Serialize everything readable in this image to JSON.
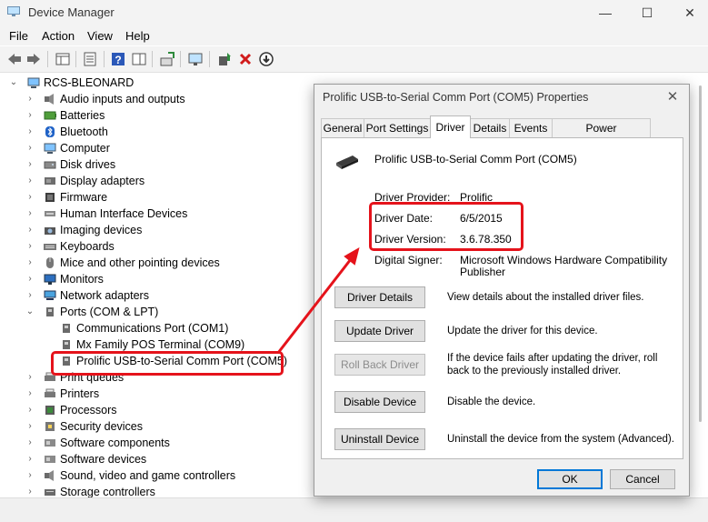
{
  "window": {
    "title": "Device Manager",
    "minimize": "—",
    "maximize": "☐",
    "close": "✕"
  },
  "menu": [
    "File",
    "Action",
    "View",
    "Help"
  ],
  "tree": {
    "root": "RCS-BLEONARD",
    "categories_before": [
      {
        "label": "Audio inputs and outputs",
        "icon": "speaker-icon"
      },
      {
        "label": "Batteries",
        "icon": "battery-icon"
      },
      {
        "label": "Bluetooth",
        "icon": "bluetooth-icon"
      },
      {
        "label": "Computer",
        "icon": "computer-icon"
      },
      {
        "label": "Disk drives",
        "icon": "disk-icon"
      },
      {
        "label": "Display adapters",
        "icon": "display-adapter-icon"
      },
      {
        "label": "Firmware",
        "icon": "chip-icon"
      },
      {
        "label": "Human Interface Devices",
        "icon": "hid-icon"
      },
      {
        "label": "Imaging devices",
        "icon": "camera-icon"
      },
      {
        "label": "Keyboards",
        "icon": "keyboard-icon"
      },
      {
        "label": "Mice and other pointing devices",
        "icon": "mouse-icon"
      },
      {
        "label": "Monitors",
        "icon": "monitor-icon"
      },
      {
        "label": "Network adapters",
        "icon": "network-icon"
      }
    ],
    "ports": {
      "label": "Ports (COM & LPT)",
      "children": [
        "Communications Port (COM1)",
        "Mx Family POS Terminal (COM9)",
        "Prolific USB-to-Serial Comm Port (COM5)"
      ]
    },
    "categories_after": [
      {
        "label": "Print queues",
        "icon": "printer-icon"
      },
      {
        "label": "Printers",
        "icon": "printer-icon"
      },
      {
        "label": "Processors",
        "icon": "cpu-icon"
      },
      {
        "label": "Security devices",
        "icon": "security-icon"
      },
      {
        "label": "Software components",
        "icon": "component-icon"
      },
      {
        "label": "Software devices",
        "icon": "component-icon"
      },
      {
        "label": "Sound, video and game controllers",
        "icon": "speaker-icon"
      },
      {
        "label": "Storage controllers",
        "icon": "storage-icon"
      }
    ]
  },
  "dialog": {
    "title": "Prolific USB-to-Serial Comm Port (COM5) Properties",
    "tabs": [
      "General",
      "Port Settings",
      "Driver",
      "Details",
      "Events",
      "Power Management"
    ],
    "active_tab": "Driver",
    "device_name": "Prolific USB-to-Serial Comm Port (COM5)",
    "fields": {
      "provider_label": "Driver Provider:",
      "provider_value": "Prolific",
      "date_label": "Driver Date:",
      "date_value": "6/5/2015",
      "version_label": "Driver Version:",
      "version_value": "3.6.78.350",
      "signer_label": "Digital Signer:",
      "signer_value_1": "Microsoft Windows Hardware Compatibility",
      "signer_value_2": "Publisher"
    },
    "buttons": {
      "details": "Driver Details",
      "details_desc": "View details about the installed driver files.",
      "update": "Update Driver",
      "update_desc": "Update the driver for this device.",
      "rollback": "Roll Back Driver",
      "rollback_desc_1": "If the device fails after updating the driver, roll",
      "rollback_desc_2": "back to the previously installed driver.",
      "disable": "Disable Device",
      "disable_desc": "Disable the device.",
      "uninstall": "Uninstall Device",
      "uninstall_desc": "Uninstall the device from the system (Advanced)."
    },
    "ok": "OK",
    "cancel": "Cancel"
  },
  "colors": {
    "highlight": "#e5131b",
    "accent": "#0078d7"
  }
}
